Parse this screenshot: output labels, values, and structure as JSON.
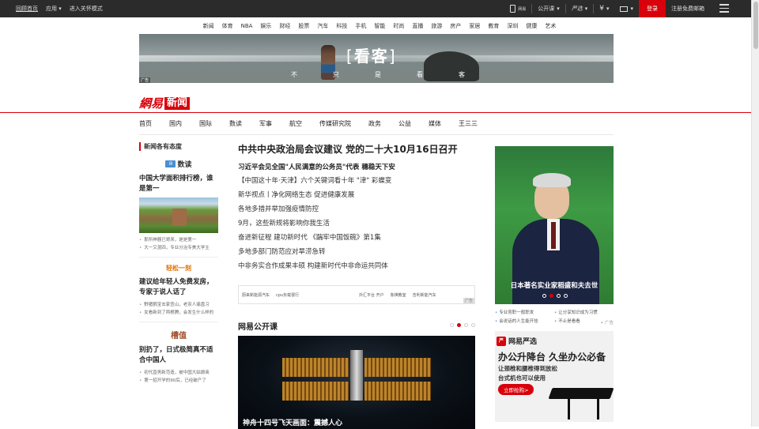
{
  "topbar": {
    "left": [
      "回顾首页",
      "应用",
      "进入关怀模式"
    ],
    "right": {
      "client": "网易",
      "open_class": "公开课",
      "yanxuan": "严选",
      "login": "登录",
      "register": "注册免费邮箱"
    }
  },
  "channels": [
    "新闻",
    "体育",
    "NBA",
    "娱乐",
    "财经",
    "股票",
    "汽车",
    "科技",
    "手机",
    "智能",
    "时尚",
    "直播",
    "旅游",
    "房产",
    "家居",
    "教育",
    "深圳",
    "健康",
    "艺术"
  ],
  "banner": {
    "logo": "看客",
    "tagline": [
      "不",
      "只",
      "是",
      "看",
      "客"
    ],
    "ad_label": "广告"
  },
  "brand": {
    "wangyi": "網易",
    "news": "新闻"
  },
  "main_nav": [
    "首页",
    "国内",
    "国际",
    "数读",
    "军事",
    "航空",
    "传媒研究院",
    "政务",
    "公益",
    "媒体",
    "王三三"
  ],
  "left": {
    "section_title": "新闻各有态度",
    "blocks": [
      {
        "sub_title": "数读",
        "headline": "中国大学面积排行榜，谁是第一",
        "links": [
          "那所神器已哥来，是是第一",
          "大一又混四，专业分治专美大学主"
        ]
      },
      {
        "sub_title": "轻松一刻",
        "headline": "建议给年轻人免费发房，专家于说人话了",
        "links": [
          "野猪鹦宝击家查山，老奈人痛盘习",
          "女看新到了两根腾，会发生什么样的"
        ]
      },
      {
        "sub_title": "槽值",
        "headline": "别扔了，日式极简真不适合中国人",
        "links": [
          "初代直男新范造，被中国大姑娘商",
          "第一招开学的90后，已经破产了"
        ]
      }
    ]
  },
  "center": {
    "lead": "中共中央政治局会议建议 党的二十大10月16日召开",
    "lead2": "习近平会见全国\"人民满意的公务员\"代表  穗稳天下安",
    "items": [
      "【中国这十年·天津】六个关键词看十年 \"津\" 彩蝶变",
      "新华视点丨净化网络生态 促进健康发展",
      "各地多措并举加强疫情防控",
      "9月，这些新规将影响你我生活",
      "奋进新征程 建功新时代  《踹牢中国饭碗》第1集",
      "多地多部门防范应对旱涝急转",
      "中非务实合作成果丰硕 构建新时代中非命运共同体"
    ],
    "adbox": {
      "links": [
        "厨来新能源汽车",
        "cpu负载很行",
        "外汇平台 开户",
        "象棋教室",
        "吉利新能汽车"
      ],
      "ad_label": "广告"
    },
    "open_class": {
      "title": "网易公开课",
      "caption": "神舟十四号飞天画面：震撼人心"
    }
  },
  "right": {
    "portrait_caption": "日本著名实业家稻盛和夫去世",
    "links": [
      "专业育职一般职发",
      "让分享知识成为习惯",
      "会说话的人生能开挂",
      "不止是看看"
    ],
    "ad_label": "广告",
    "yanxuan": {
      "logo": "网易严选",
      "title": "办公升降台 久坐办公必备",
      "line1": "让颈椎和腰椎得到放松",
      "line2": "台式机也可以使用",
      "button": "立即抢购>"
    }
  }
}
